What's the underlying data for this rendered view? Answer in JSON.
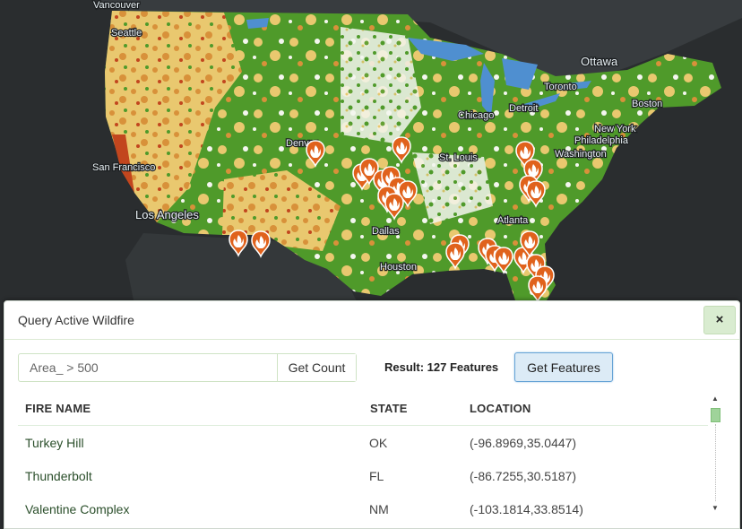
{
  "map": {
    "cities": [
      "Vancouver",
      "Seattle",
      "Ottawa",
      "Toronto",
      "Boston",
      "Detroit",
      "Chicago",
      "New York",
      "Philadelphia",
      "Washington",
      "St. Louis",
      "Denver",
      "San Francisco",
      "Los Angeles",
      "Dallas",
      "Atlanta",
      "Houston"
    ],
    "marker_icon": "fire-icon",
    "colors": {
      "ocean": "#2a2d2f",
      "water": "#4f8fd0",
      "forest": "#4f9a2a",
      "grass": "#e9c86f",
      "shrub": "#d8913a",
      "dry": "#c2461e",
      "open": "#f4f6ef"
    }
  },
  "panel": {
    "title": "Query Active Wildfire",
    "close_label": "×",
    "query": {
      "value": "Area_ > 500",
      "placeholder": ""
    },
    "get_count_label": "Get Count",
    "result_text": "Result: 127 Features",
    "get_features_label": "Get Features",
    "table": {
      "columns": [
        "FIRE NAME",
        "STATE",
        "LOCATION"
      ],
      "rows": [
        {
          "name": "Turkey Hill",
          "state": "OK",
          "location": "(-96.8969,35.0447)"
        },
        {
          "name": "Thunderbolt",
          "state": "FL",
          "location": "(-86.7255,30.5187)"
        },
        {
          "name": "Valentine Complex",
          "state": "NM",
          "location": "(-103.1814,33.8514)"
        }
      ]
    }
  }
}
